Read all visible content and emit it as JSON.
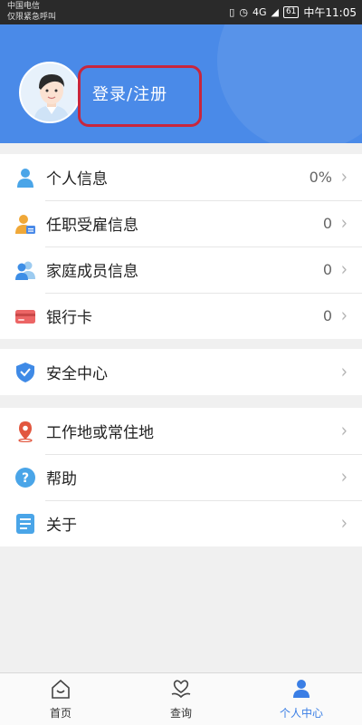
{
  "status_bar": {
    "carrier_line1": "中国电信",
    "carrier_line2": "仅限紧急呼叫",
    "signal": "4G",
    "battery": "61",
    "time": "中午11:05"
  },
  "header": {
    "login_label": "登录/注册",
    "brand_color": "#4a8ae8"
  },
  "groups": [
    {
      "items": [
        {
          "label": "个人信息",
          "value": "0%",
          "icon": "person-icon"
        },
        {
          "label": "任职受雇信息",
          "value": "0",
          "icon": "employment-icon"
        },
        {
          "label": "家庭成员信息",
          "value": "0",
          "icon": "family-icon"
        },
        {
          "label": "银行卡",
          "value": "0",
          "icon": "bank-card-icon"
        }
      ]
    },
    {
      "items": [
        {
          "label": "安全中心",
          "value": "",
          "icon": "shield-icon"
        }
      ]
    },
    {
      "items": [
        {
          "label": "工作地或常住地",
          "value": "",
          "icon": "location-pin-icon"
        },
        {
          "label": "帮助",
          "value": "",
          "icon": "help-icon"
        },
        {
          "label": "关于",
          "value": "",
          "icon": "about-icon"
        }
      ]
    }
  ],
  "tabbar": {
    "tabs": [
      {
        "label": "首页",
        "icon": "home-icon"
      },
      {
        "label": "查询",
        "icon": "heart-hand-icon"
      },
      {
        "label": "个人中心",
        "icon": "profile-icon",
        "active": true
      }
    ],
    "active_color": "#3a7ee5"
  }
}
